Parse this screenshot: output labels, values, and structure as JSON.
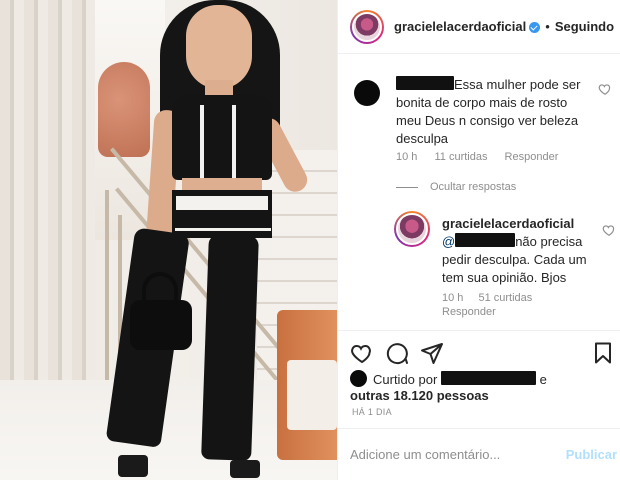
{
  "post": {
    "author": "gracielelacerdaoficial",
    "follow_separator": "•",
    "follow_status": "Seguindo"
  },
  "comment": {
    "text": "Essa mulher pode ser bonita de corpo mais de rosto meu Deus n consigo ver beleza desculpa",
    "time": "10 h",
    "likes": "11 curtidas",
    "reply_label": "Responder"
  },
  "hide_replies_label": "Ocultar respostas",
  "reply": {
    "author": "gracielelacerdaoficial",
    "mention_prefix": "@",
    "text": "não precisa pedir desculpa. Cada um tem sua opinião. Bjos",
    "time": "10 h",
    "likes": "51 curtidas",
    "reply_label": "Responder"
  },
  "likes": {
    "prefix": "Curtido por",
    "suffix": "e",
    "others": "outras 18.120 pessoas"
  },
  "posted_ago": "HÁ 1 DIA",
  "add_comment": {
    "placeholder": "Adicione um comentário...",
    "publish_label": "Publicar"
  },
  "icons": {
    "like": "heart-icon",
    "comment": "comment-icon",
    "share": "share-icon",
    "save": "bookmark-icon"
  },
  "colors": {
    "verified": "#3897f0",
    "link": "#00376b",
    "muted": "#8e8e8e",
    "publish_disabled": "#b2dffc"
  }
}
